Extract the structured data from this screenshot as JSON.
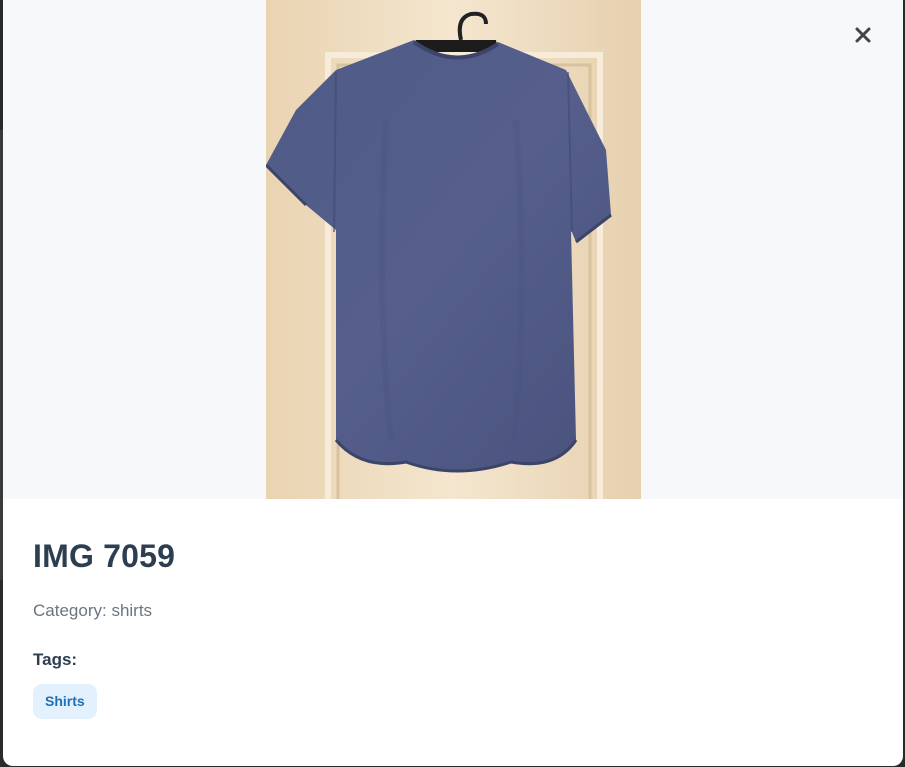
{
  "modal": {
    "title": "IMG 7059",
    "category_prefix": "Category: ",
    "category_value": "shirts",
    "tags_label": "Tags:",
    "tags": [
      "Shirts"
    ],
    "close_icon": "close-icon",
    "image_subject": "shirt-photo"
  },
  "colors": {
    "title": "#2c3e50",
    "muted": "#6c757d",
    "tag_bg": "#e3f0fd",
    "tag_text": "#1f6fb8",
    "image_bg": "#f6f8fa"
  }
}
